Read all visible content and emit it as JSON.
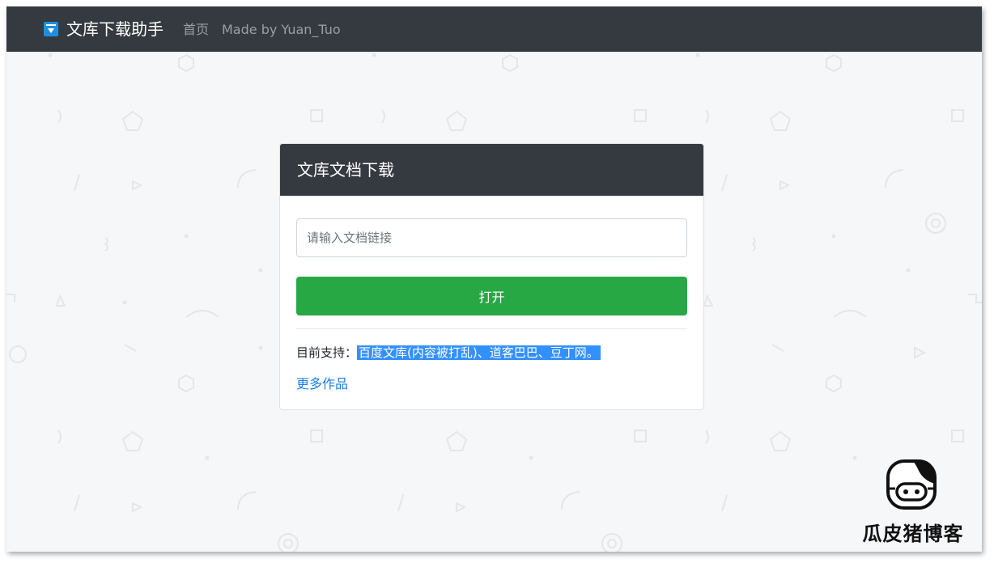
{
  "navbar": {
    "brand": "文库下载助手",
    "links": [
      "首页",
      "Made by Yuan_Tuo"
    ]
  },
  "card": {
    "title": "文库文档下载",
    "input_placeholder": "请输入文档链接",
    "input_value": "",
    "open_label": "打开",
    "support_prefix": "目前支持：",
    "support_sites": "百度文库(内容被打乱)、道客巴巴、豆丁网。",
    "more_link": "更多作品"
  },
  "watermark": {
    "text": "瓜皮猪博客"
  },
  "colors": {
    "navbar": "#343a40",
    "button": "#28a745",
    "link": "#1a7ee0",
    "selection": "#3390ff",
    "background": "#f6f7f9"
  }
}
